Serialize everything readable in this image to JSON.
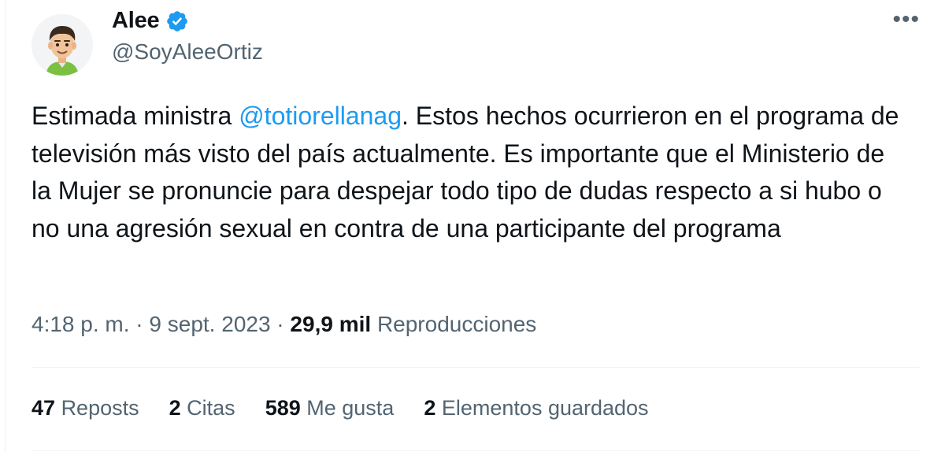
{
  "author": {
    "display_name": "Alee",
    "handle": "@SoyAleeOrtiz",
    "verified_icon": "verified-badge-icon",
    "avatar_icon": "cartoon-man-avatar"
  },
  "more_icon": "more-options-icon",
  "tweet": {
    "text_before_mention": "Estimada ministra ",
    "mention": "@totiorellanag",
    "text_after_mention": ". Estos hechos ocurrieron en el programa de televisión más visto del país actualmente. Es importante que el Ministerio de la Mujer se pronuncie para despejar todo tipo de dudas respecto a si hubo o no una agresión sexual en contra de una participante del programa"
  },
  "meta": {
    "time": "4:18 p. m.",
    "separator": " · ",
    "date": "9 sept. 2023",
    "views_count": "29,9 mil",
    "views_label": "Reproducciones"
  },
  "stats": [
    {
      "count": "47",
      "label": "Reposts"
    },
    {
      "count": "2",
      "label": "Citas"
    },
    {
      "count": "589",
      "label": "Me gusta"
    },
    {
      "count": "2",
      "label": "Elementos guardados"
    }
  ],
  "colors": {
    "link": "#1d9bf0",
    "secondary_text": "#536471",
    "primary_text": "#0f1419",
    "divider": "#eff3f4"
  }
}
